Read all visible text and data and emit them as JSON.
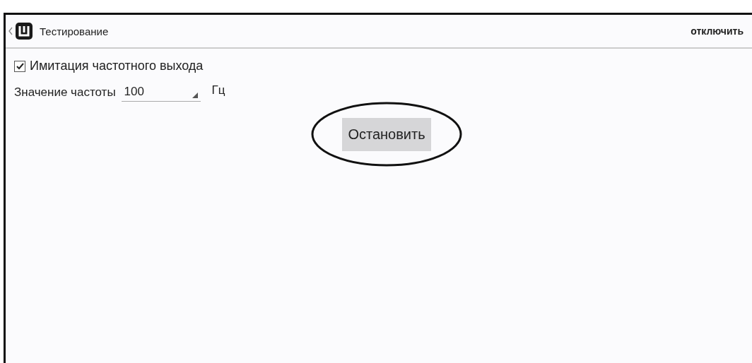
{
  "action_bar": {
    "title": "Тестирование",
    "action": "отключить"
  },
  "simulation": {
    "label": "Имитация частотного выхода",
    "checked": true
  },
  "frequency": {
    "label": "Значение частоты",
    "value": "100",
    "unit": "Гц"
  },
  "stop_button": {
    "label": "Остановить",
    "highlighted": true
  }
}
